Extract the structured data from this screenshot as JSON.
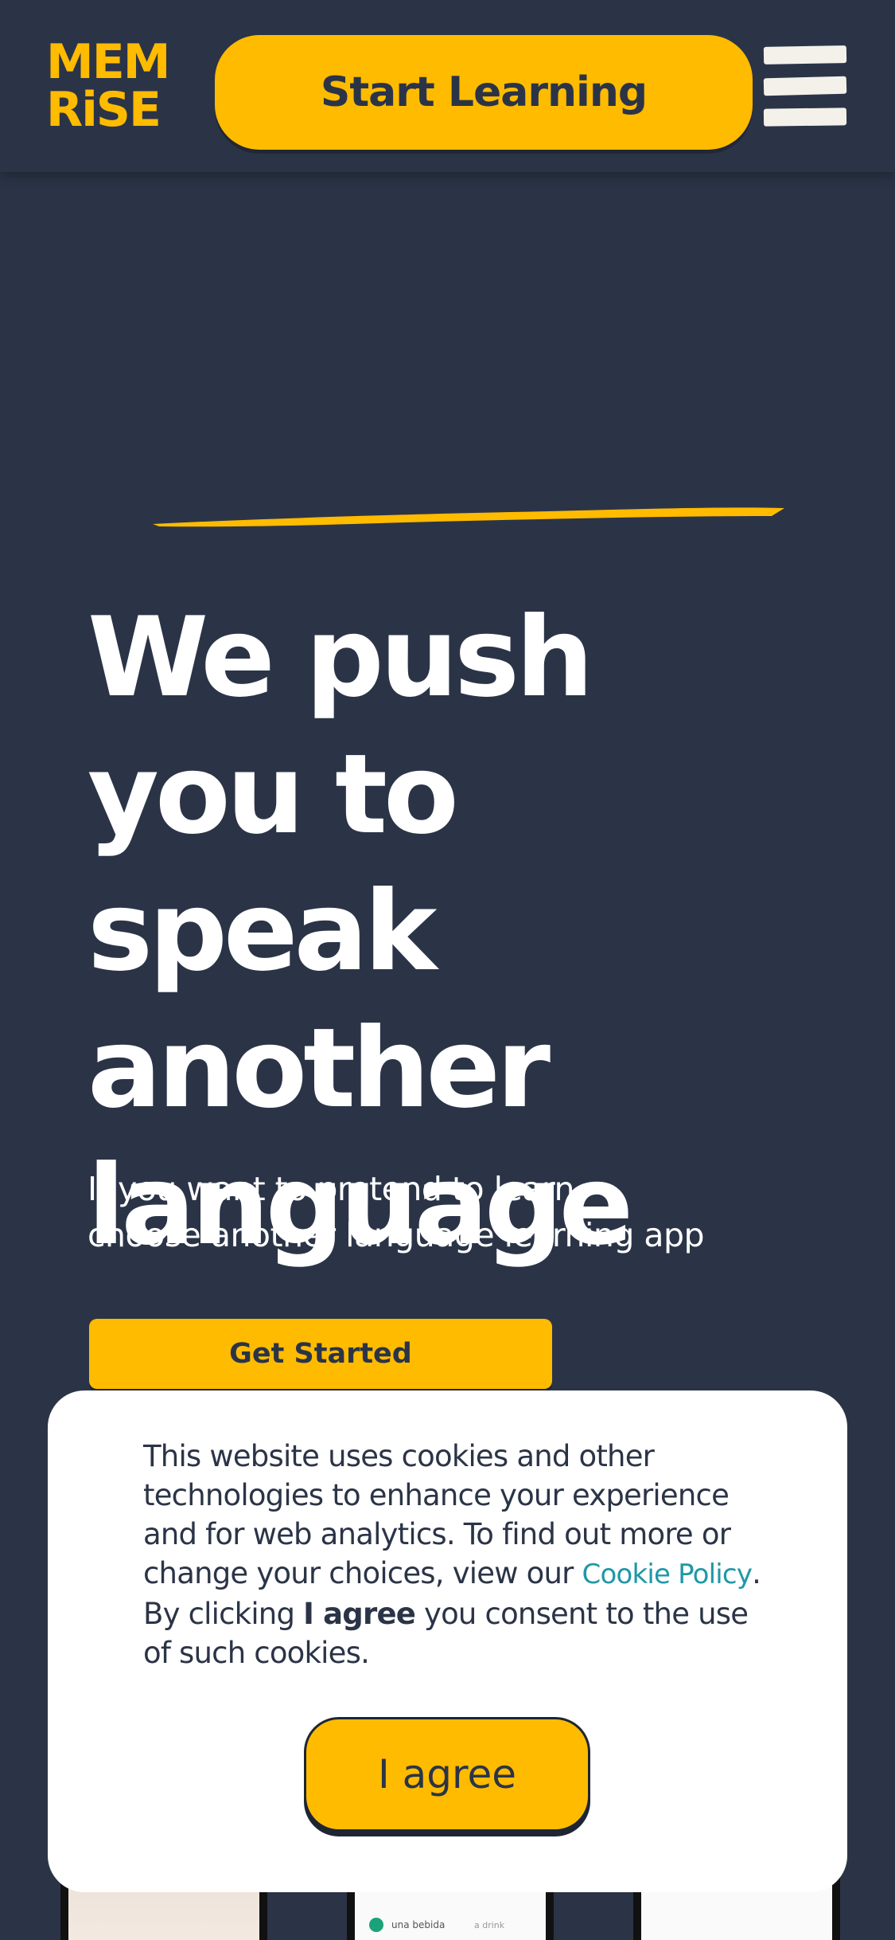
{
  "colors": {
    "background": "#2b3447",
    "accent": "#ffbb00",
    "text_light": "#ffffff",
    "link": "#1f98a6"
  },
  "header": {
    "logo_line1": "MEM",
    "logo_line2": "RiSE",
    "start_button": "Start Learning",
    "menu_icon": "hamburger-menu-icon"
  },
  "hero": {
    "title": "We push you to speak another language",
    "subtitle_line1": "If you want to pretend to learn,",
    "subtitle_line2": "choose another language learning app",
    "cta": "Get Started"
  },
  "preview_phone": {
    "row_label": "una bebida",
    "row_value": "a drink"
  },
  "cookie_banner": {
    "text_before_link": "This website uses cookies and other technologies to enhance your experience and for web analytics. To find out more or change your choices, view our ",
    "link_text": "Cookie Policy",
    "text_after_link": ". By clicking ",
    "bold_text": "I agree",
    "text_end": " you consent to the use of such cookies.",
    "agree_button": "I agree"
  }
}
